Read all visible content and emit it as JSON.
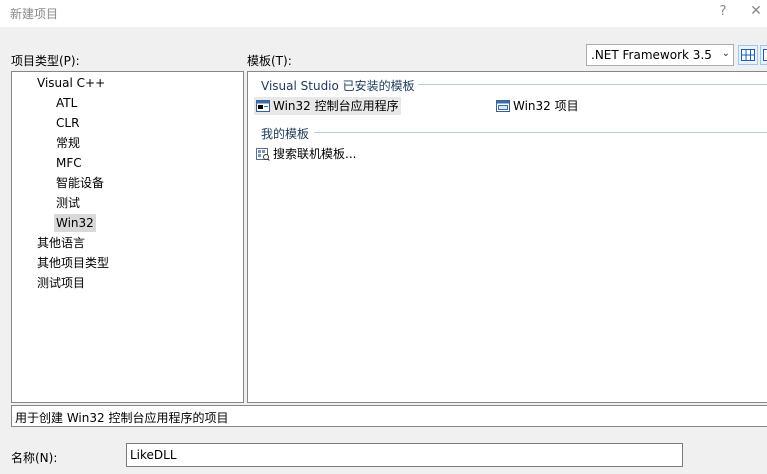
{
  "window": {
    "title": "新建项目",
    "help_label": "?",
    "close_label": "✕"
  },
  "project_types": {
    "label": "项目类型(P):",
    "items": [
      {
        "label": "Visual C++",
        "level": 0
      },
      {
        "label": "ATL",
        "level": 1
      },
      {
        "label": "CLR",
        "level": 1
      },
      {
        "label": "常规",
        "level": 1
      },
      {
        "label": "MFC",
        "level": 1
      },
      {
        "label": "智能设备",
        "level": 1
      },
      {
        "label": "测试",
        "level": 1
      },
      {
        "label": "Win32",
        "level": 1,
        "selected": true
      },
      {
        "label": "其他语言",
        "level": 0
      },
      {
        "label": "其他项目类型",
        "level": 0
      },
      {
        "label": "测试项目",
        "level": 0
      }
    ]
  },
  "templates": {
    "label": "模板(T):",
    "framework": ".NET Framework 3.5",
    "installed_group": "Visual Studio 已安装的模板",
    "installed": [
      {
        "label": "Win32 控制台应用程序",
        "icon": "console-app-icon",
        "selected": true
      },
      {
        "label": "Win32 项目",
        "icon": "win32-project-icon"
      }
    ],
    "my_group": "我的模板",
    "my_items": [
      {
        "label": "搜索联机模板...",
        "icon": "search-online-icon"
      }
    ]
  },
  "description": "用于创建 Win32 控制台应用程序的项目",
  "name_field": {
    "label": "名称(N):",
    "value": "LikeDLL"
  }
}
